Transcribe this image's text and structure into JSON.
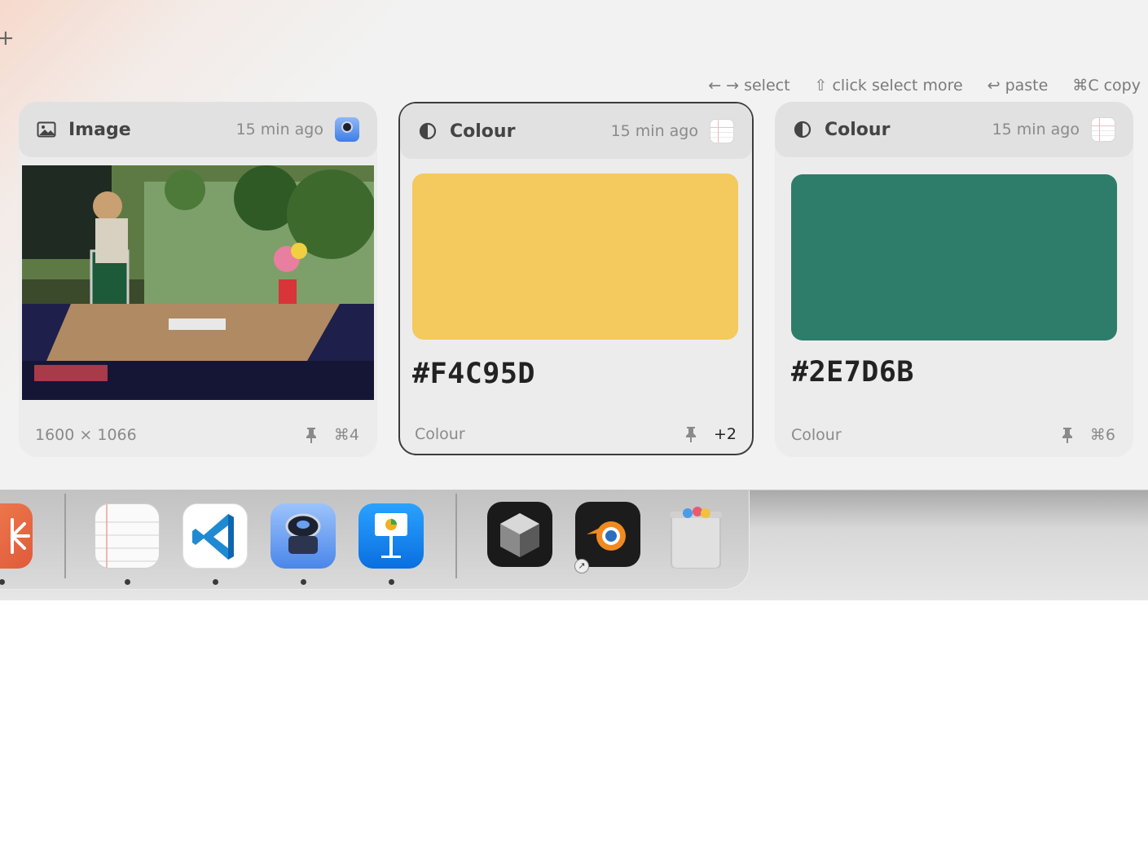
{
  "hints": [
    {
      "keys": "← →",
      "label": "select"
    },
    {
      "keys": "⇧",
      "label": "click select more"
    },
    {
      "keys": "↩",
      "label": "paste"
    },
    {
      "keys": "⌘C",
      "label": "copy"
    }
  ],
  "cards": [
    {
      "type_label": "Image",
      "time": "15 min ago",
      "footer_left": "1600 × 1066",
      "footer_right": "⌘4",
      "icon": "image-icon",
      "app_badge": "preview-app-icon"
    },
    {
      "type_label": "Colour",
      "time": "15 min ago",
      "hex": "#F4C95D",
      "swatch_color": "#F4C95D",
      "footer_left": "Colour",
      "footer_right": "+2",
      "icon": "contrast-icon",
      "app_badge": "notes-app-icon",
      "selected": true
    },
    {
      "type_label": "Colour",
      "time": "15 min ago",
      "hex": "#2E7D6B",
      "swatch_color": "#2E7D6B",
      "footer_left": "Colour",
      "footer_right": "⌘6",
      "icon": "contrast-icon",
      "app_badge": "notes-app-icon"
    }
  ],
  "dock": {
    "apps": [
      "sparkle-app-icon",
      "notes-app-icon",
      "vscode-app-icon",
      "preview-app-icon",
      "keynote-app-icon",
      "cube-app-icon",
      "blender-app-icon",
      "trash-icon"
    ]
  },
  "colors": {
    "selected_border": "#3C3C3C",
    "panel_bg": "#F2F2F2"
  }
}
